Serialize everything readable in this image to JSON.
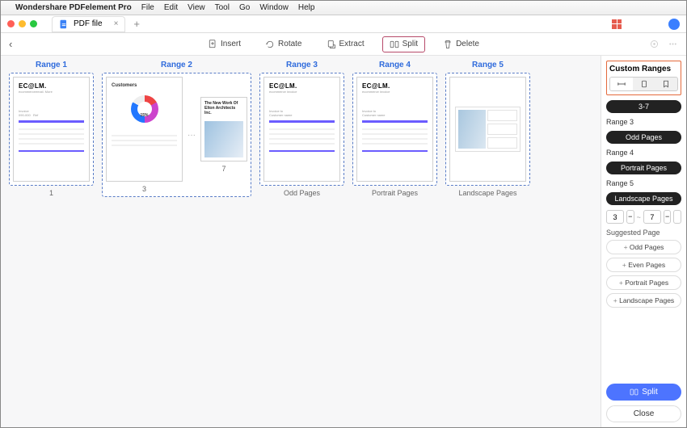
{
  "menubar": {
    "app": "Wondershare PDFelement Pro",
    "items": [
      "File",
      "Edit",
      "View",
      "Tool",
      "Go",
      "Window",
      "Help"
    ]
  },
  "tab": {
    "title": "PDF file"
  },
  "toolbar": {
    "insert": "Insert",
    "rotate": "Rotate",
    "extract": "Extract",
    "split": "Split",
    "delete": "Delete"
  },
  "ranges": [
    {
      "title": "Range 1",
      "sub": "1"
    },
    {
      "title": "Range 2",
      "sub_a": "3",
      "sub_b": "7"
    },
    {
      "title": "Range 3",
      "sub": "Odd Pages"
    },
    {
      "title": "Range 4",
      "sub": "Portrait Pages"
    },
    {
      "title": "Range 5",
      "sub": "Landscape Pages"
    }
  ],
  "thumb": {
    "logo": "EC@LM.",
    "tag1": "ecommerceemail. More",
    "tag2": "ecommerce invoice",
    "cust": "Customers",
    "donut_pct": "15%",
    "arch": "The New Work Of Elton Architects Inc."
  },
  "panel": {
    "title": "Custom Ranges",
    "chip": "3-7",
    "r3_label": "Range 3",
    "r3_chip": "Odd Pages",
    "r4_label": "Range 4",
    "r4_chip": "Portrait Pages",
    "r5_label": "Range 5",
    "r5_chip": "Landscape Pages",
    "from": "3",
    "to": "7",
    "sugg_title": "Suggested Page",
    "sugg": [
      "Odd Pages",
      "Even Pages",
      "Portrait Pages",
      "Landscape Pages"
    ],
    "split_btn": "Split",
    "close_btn": "Close"
  }
}
